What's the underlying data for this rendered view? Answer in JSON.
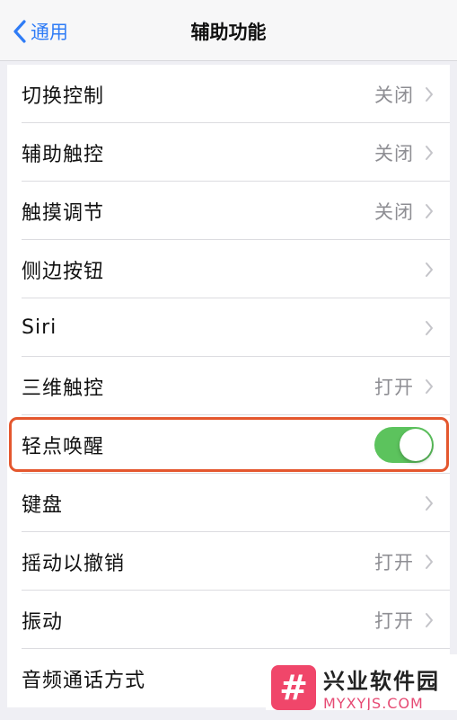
{
  "nav": {
    "back_label": "通用",
    "title": "辅助功能"
  },
  "rows": [
    {
      "label": "切换控制",
      "value": "关闭"
    },
    {
      "label": "辅助触控",
      "value": "关闭"
    },
    {
      "label": "触摸调节",
      "value": "关闭"
    },
    {
      "label": "侧边按钮",
      "value": ""
    },
    {
      "label": "Siri",
      "value": ""
    },
    {
      "label": "三维触控",
      "value": "打开"
    },
    {
      "label": "轻点唤醒",
      "toggle_on": true
    },
    {
      "label": "键盘",
      "value": ""
    },
    {
      "label": "摇动以撤销",
      "value": "打开"
    },
    {
      "label": "振动",
      "value": "打开"
    },
    {
      "label": "音频通话方式",
      "value": ""
    }
  ],
  "watermark": {
    "logo_glyph": "#",
    "name": "兴业软件园",
    "domain": "MYXYJS.COM"
  },
  "colors": {
    "accent": "#2f7cf6",
    "toggle_on": "#5cc35d",
    "highlight": "#e4572e",
    "secondary_text": "#8e8e93"
  }
}
